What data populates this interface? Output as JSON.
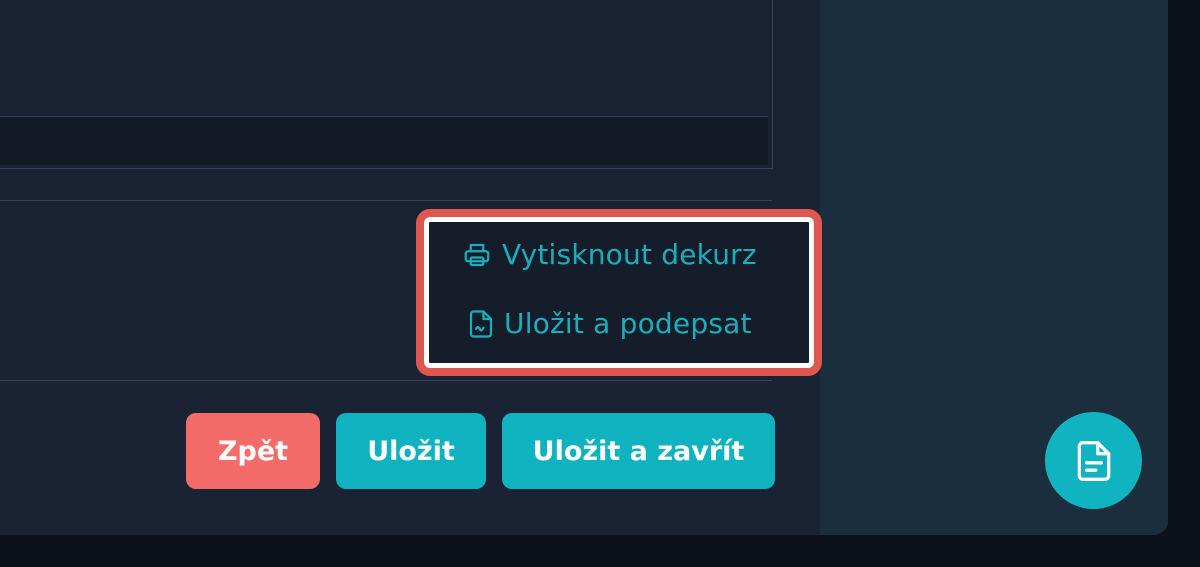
{
  "actions": {
    "print_label": "Vytisknout dekurz",
    "print_icon": "printer-icon",
    "sign_label": "Uložit a podepsat",
    "sign_icon": "signature-document-icon"
  },
  "footer": {
    "back_label": "Zpět",
    "save_label": "Uložit",
    "save_close_label": "Uložit a zavřít"
  },
  "fab": {
    "icon": "document-icon"
  },
  "colors": {
    "accent": "#0eb3bf",
    "danger": "#f36c6a",
    "highlight_border": "#e0574f",
    "background": "#1a2334"
  }
}
